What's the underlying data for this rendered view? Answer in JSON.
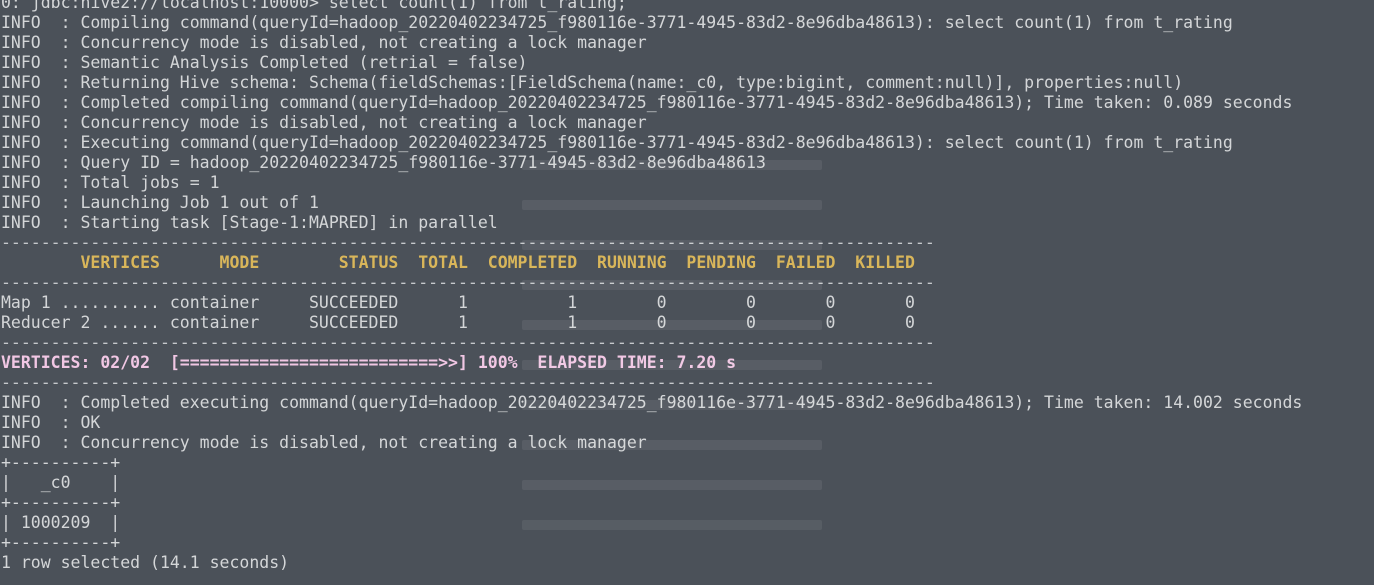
{
  "terminal": {
    "lines": [
      {
        "kind": "text",
        "text": "0: jdbc:hive2://localhost:10000> select count(1) from t_rating;"
      },
      {
        "kind": "text",
        "text": "INFO  : Compiling command(queryId=hadoop_20220402234725_f980116e-3771-4945-83d2-8e96dba48613): select count(1) from t_rating"
      },
      {
        "kind": "text",
        "text": "INFO  : Concurrency mode is disabled, not creating a lock manager"
      },
      {
        "kind": "text",
        "text": "INFO  : Semantic Analysis Completed (retrial = false)"
      },
      {
        "kind": "text",
        "text": "INFO  : Returning Hive schema: Schema(fieldSchemas:[FieldSchema(name:_c0, type:bigint, comment:null)], properties:null)"
      },
      {
        "kind": "text",
        "text": "INFO  : Completed compiling command(queryId=hadoop_20220402234725_f980116e-3771-4945-83d2-8e96dba48613); Time taken: 0.089 seconds"
      },
      {
        "kind": "text",
        "text": "INFO  : Concurrency mode is disabled, not creating a lock manager"
      },
      {
        "kind": "text",
        "text": "INFO  : Executing command(queryId=hadoop_20220402234725_f980116e-3771-4945-83d2-8e96dba48613): select count(1) from t_rating"
      },
      {
        "kind": "text",
        "text": "INFO  : Query ID = hadoop_20220402234725_f980116e-3771-4945-83d2-8e96dba48613"
      },
      {
        "kind": "text",
        "text": "INFO  : Total jobs = 1"
      },
      {
        "kind": "text",
        "text": "INFO  : Launching Job 1 out of 1"
      },
      {
        "kind": "text",
        "text": "INFO  : Starting task [Stage-1:MAPRED] in parallel"
      },
      {
        "kind": "sep",
        "text": "----------------------------------------------------------------------------------------------"
      },
      {
        "kind": "hdr",
        "text": "        VERTICES      MODE        STATUS  TOTAL  COMPLETED  RUNNING  PENDING  FAILED  KILLED"
      },
      {
        "kind": "sep",
        "text": "----------------------------------------------------------------------------------------------"
      },
      {
        "kind": "text",
        "text": "Map 1 .......... container     SUCCEEDED      1          1        0        0       0       0"
      },
      {
        "kind": "text",
        "text": "Reducer 2 ...... container     SUCCEEDED      1          1        0        0       0       0"
      },
      {
        "kind": "sep",
        "text": "----------------------------------------------------------------------------------------------"
      },
      {
        "kind": "prog",
        "text": "VERTICES: 02/02  [==========================>>] 100%  ELAPSED TIME: 7.20 s"
      },
      {
        "kind": "sep",
        "text": "----------------------------------------------------------------------------------------------"
      },
      {
        "kind": "text",
        "text": "INFO  : Completed executing command(queryId=hadoop_20220402234725_f980116e-3771-4945-83d2-8e96dba48613); Time taken: 14.002 seconds"
      },
      {
        "kind": "text",
        "text": "INFO  : OK"
      },
      {
        "kind": "text",
        "text": "INFO  : Concurrency mode is disabled, not creating a lock manager"
      },
      {
        "kind": "text",
        "text": "+----------+"
      },
      {
        "kind": "text",
        "text": "|   _c0    |"
      },
      {
        "kind": "text",
        "text": "+----------+"
      },
      {
        "kind": "text",
        "text": "| 1000209  |"
      },
      {
        "kind": "text",
        "text": "+----------+"
      },
      {
        "kind": "text",
        "text": "1 row selected (14.1 seconds)"
      }
    ]
  },
  "colors": {
    "background": "#4b5159",
    "text": "#d4d6d8",
    "header": "#d9b65a",
    "progress": "#f1c7e4"
  }
}
